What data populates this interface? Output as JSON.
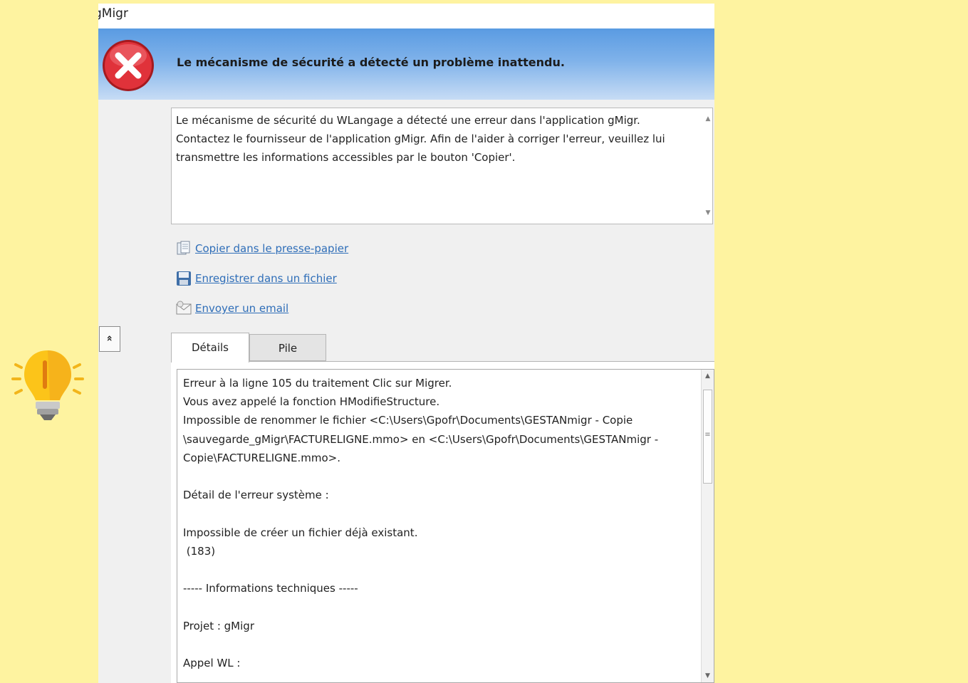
{
  "window": {
    "title": "gMigr"
  },
  "banner": {
    "title": "Le mécanisme de sécurité a détecté un problème inattendu."
  },
  "message": {
    "text": "Le mécanisme de sécurité du WLangage a détecté une erreur dans l'application gMigr. Contactez le fournisseur de l'application gMigr. Afin de l'aider à corriger l'erreur, veuillez lui transmettre les informations accessibles par le bouton 'Copier'."
  },
  "actions": {
    "copy": "Copier dans le presse-papier",
    "save": "Enregistrer dans un fichier",
    "email": "Envoyer un email"
  },
  "collapse": {
    "symbol": "«"
  },
  "tabs": [
    {
      "label": "Détails",
      "active": true
    },
    {
      "label": "Pile",
      "active": false
    }
  ],
  "details": {
    "text": "Erreur à la ligne 105 du traitement Clic sur Migrer.\nVous avez appelé la fonction HModifieStructure.\nImpossible de renommer le fichier <C:\\Users\\Gpofr\\Documents\\GESTANmigr - Copie\n\\sauvegarde_gMigr\\FACTURELIGNE.mmo> en <C:\\Users\\Gpofr\\Documents\\GESTANmigr -\nCopie\\FACTURELIGNE.mmo>.\n\nDétail de l'erreur système :\n\nImpossible de créer un fichier déjà existant.\n (183)\n\n----- Informations techniques -----\n\nProjet : gMigr\n\nAppel WL :"
  },
  "colors": {
    "background": "#fef3a0",
    "banner": "#7fb2ea",
    "link": "#2f6eb8",
    "error": "#d9262c"
  }
}
